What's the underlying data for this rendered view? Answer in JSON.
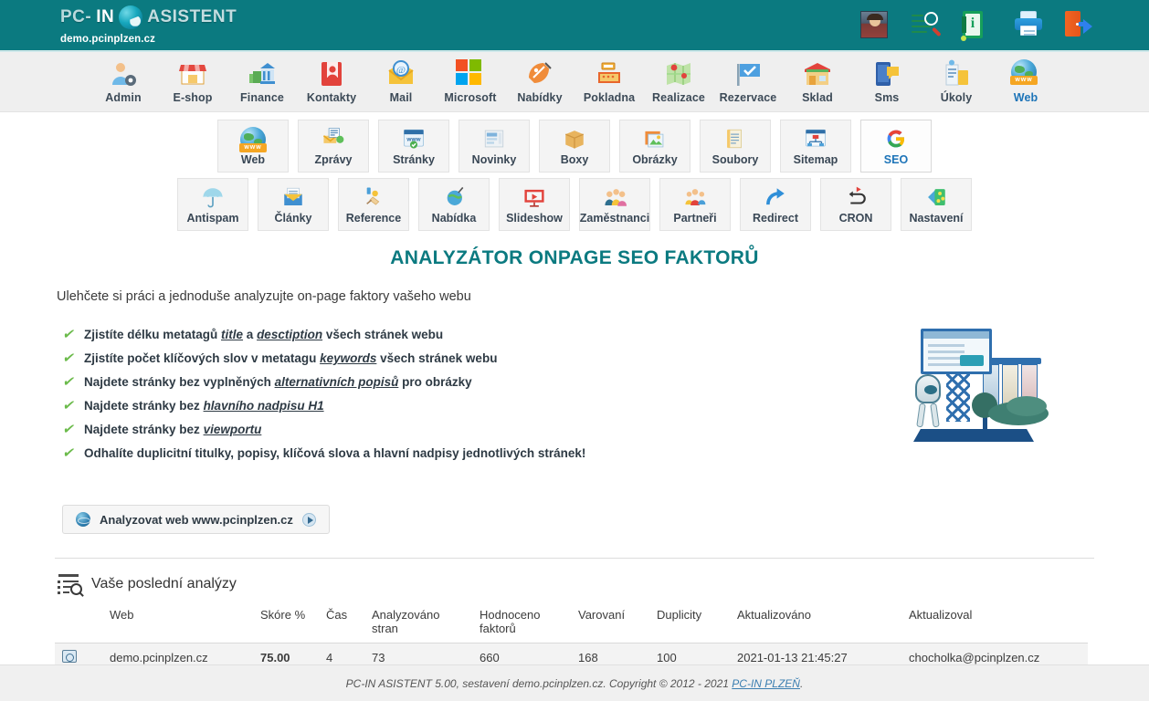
{
  "brand": {
    "part1": "PC-",
    "part2": "IN",
    "part3": "ASISTENT",
    "subtitle": "demo.pcinplzen.cz"
  },
  "top_icons": [
    {
      "name": "user-avatar",
      "label": "Profil"
    },
    {
      "name": "search-analytics-icon",
      "label": "Hledat"
    },
    {
      "name": "info-card-icon",
      "label": "Info"
    },
    {
      "name": "printer-icon",
      "label": "Tisk"
    },
    {
      "name": "logout-icon",
      "label": "Odhlásit"
    }
  ],
  "main_nav": [
    {
      "label": "Admin",
      "icon": "admin-icon",
      "active": false
    },
    {
      "label": "E-shop",
      "icon": "eshop-icon",
      "active": false
    },
    {
      "label": "Finance",
      "icon": "finance-icon",
      "active": false
    },
    {
      "label": "Kontakty",
      "icon": "contacts-icon",
      "active": false
    },
    {
      "label": "Mail",
      "icon": "mail-icon",
      "active": false
    },
    {
      "label": "Microsoft",
      "icon": "microsoft-icon",
      "active": false
    },
    {
      "label": "Nabídky",
      "icon": "offers-icon",
      "active": false
    },
    {
      "label": "Pokladna",
      "icon": "cashier-icon",
      "active": false
    },
    {
      "label": "Realizace",
      "icon": "map-icon",
      "active": false
    },
    {
      "label": "Rezervace",
      "icon": "flag-icon",
      "active": false
    },
    {
      "label": "Sklad",
      "icon": "warehouse-icon",
      "active": false
    },
    {
      "label": "Sms",
      "icon": "sms-icon",
      "active": false
    },
    {
      "label": "Úkoly",
      "icon": "tasks-icon",
      "active": false
    },
    {
      "label": "Web",
      "icon": "web-globe-icon",
      "active": true
    }
  ],
  "sub_nav_row1": [
    {
      "label": "Web",
      "icon": "web-globe-icon",
      "active": false
    },
    {
      "label": "Zprávy",
      "icon": "messages-icon",
      "active": false
    },
    {
      "label": "Stránky",
      "icon": "pages-icon",
      "active": false
    },
    {
      "label": "Novinky",
      "icon": "news-icon",
      "active": false
    },
    {
      "label": "Boxy",
      "icon": "box-icon",
      "active": false
    },
    {
      "label": "Obrázky",
      "icon": "images-icon",
      "active": false
    },
    {
      "label": "Soubory",
      "icon": "files-icon",
      "active": false
    },
    {
      "label": "Sitemap",
      "icon": "sitemap-icon",
      "active": false
    },
    {
      "label": "SEO",
      "icon": "google-g-icon",
      "active": true
    }
  ],
  "sub_nav_row2": [
    {
      "label": "Antispam",
      "icon": "umbrella-icon",
      "active": false
    },
    {
      "label": "Články",
      "icon": "articles-icon",
      "active": false
    },
    {
      "label": "Reference",
      "icon": "reference-icon",
      "active": false
    },
    {
      "label": "Nabídka",
      "icon": "menu-globe-icon",
      "active": false
    },
    {
      "label": "Slideshow",
      "icon": "slideshow-icon",
      "active": false
    },
    {
      "label": "Zaměstnanci",
      "icon": "employees-icon",
      "active": false
    },
    {
      "label": "Partneři",
      "icon": "partners-icon",
      "active": false
    },
    {
      "label": "Redirect",
      "icon": "redirect-icon",
      "active": false
    },
    {
      "label": "CRON",
      "icon": "cron-icon",
      "active": false
    },
    {
      "label": "Nastavení",
      "icon": "settings-icon",
      "active": false
    }
  ],
  "page": {
    "title": "ANALYZÁTOR ONPAGE SEO FAKTORŮ",
    "lead": "Ulehčete si práci a jednoduše analyzujte on-page faktory vašeho webu"
  },
  "features": [
    {
      "prefix": "Zjistíte délku metatagů ",
      "em1": "title",
      "mid": " a ",
      "em2": "desctiption",
      "suffix": " všech stránek webu"
    },
    {
      "prefix": "Zjistíte počet klíčových slov v metatagu ",
      "em1": "keywords",
      "mid": "",
      "em2": "",
      "suffix": " všech stránek webu"
    },
    {
      "prefix": "Najdete stránky bez vyplněných ",
      "em1": "alternativních popisů",
      "mid": "",
      "em2": "",
      "suffix": " pro obrázky"
    },
    {
      "prefix": "Najdete stránky bez ",
      "em1": "hlavního nadpisu H1",
      "mid": "",
      "em2": "",
      "suffix": ""
    },
    {
      "prefix": "Najdete stránky bez ",
      "em1": "viewportu",
      "mid": "",
      "em2": "",
      "suffix": ""
    },
    {
      "prefix": "Odhalíte duplicitní titulky, popisy, klíčová slova a hlavní nadpisy jednotlivých stránek!",
      "em1": "",
      "mid": "",
      "em2": "",
      "suffix": ""
    }
  ],
  "analyze_button": {
    "label": "Analyzovat web www.pcinplzen.cz"
  },
  "analyses": {
    "heading": "Vaše poslední analýzy",
    "columns": [
      "",
      "Web",
      "Skóre %",
      "Čas",
      "Analyzováno stran",
      "Hodnoceno faktorů",
      "Varovaní",
      "Duplicity",
      "Aktualizováno",
      "Aktualizoval"
    ],
    "rows": [
      {
        "web": "demo.pcinplzen.cz",
        "score": "75.00",
        "time": "4",
        "pages": "73",
        "factors": "660",
        "warnings": "168",
        "duplicities": "100",
        "updated": "2021-01-13 21:45:27",
        "updated_by": "chocholka@pcinplzen.cz"
      }
    ]
  },
  "footer": {
    "text": "PC-IN ASISTENT 5.00, sestavení demo.pcinplzen.cz. Copyright © 2012 - 2021 ",
    "link": "PC-IN PLZEŇ",
    "tail": "."
  },
  "colors": {
    "header_teal": "#0b7a80",
    "title_teal": "#0b7a80",
    "score_orange": "#e8930c",
    "active_blue": "#1d74b8",
    "check_green": "#6cbb4c"
  }
}
